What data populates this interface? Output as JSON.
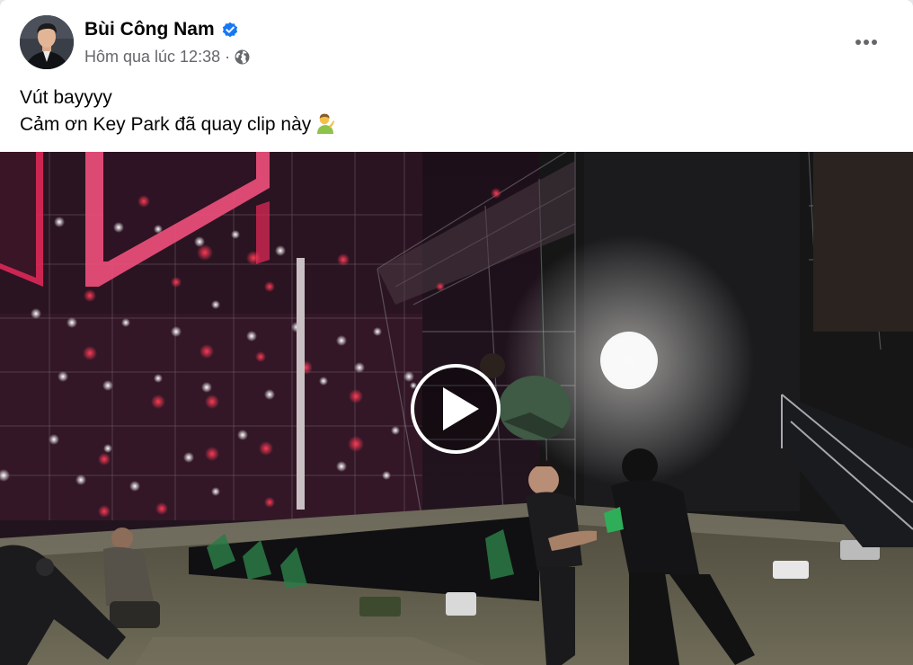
{
  "post": {
    "author": "Bùi Công Nam",
    "timestamp": "Hôm qua lúc 12:38",
    "separator": "·",
    "verified": true,
    "privacy_icon": "globe-icon",
    "more_icon": "more-options-icon",
    "text_lines": [
      "Vút bayyyy",
      "Cảm ơn Key Park đã quay clip này"
    ],
    "emoji_icon": "person-tipping-hand-emoji"
  },
  "video": {
    "play_icon": "play-icon"
  },
  "colors": {
    "name": "#050505",
    "secondary": "#65676b",
    "verified": "#1877f2",
    "stage_neon": "#e8295a"
  }
}
